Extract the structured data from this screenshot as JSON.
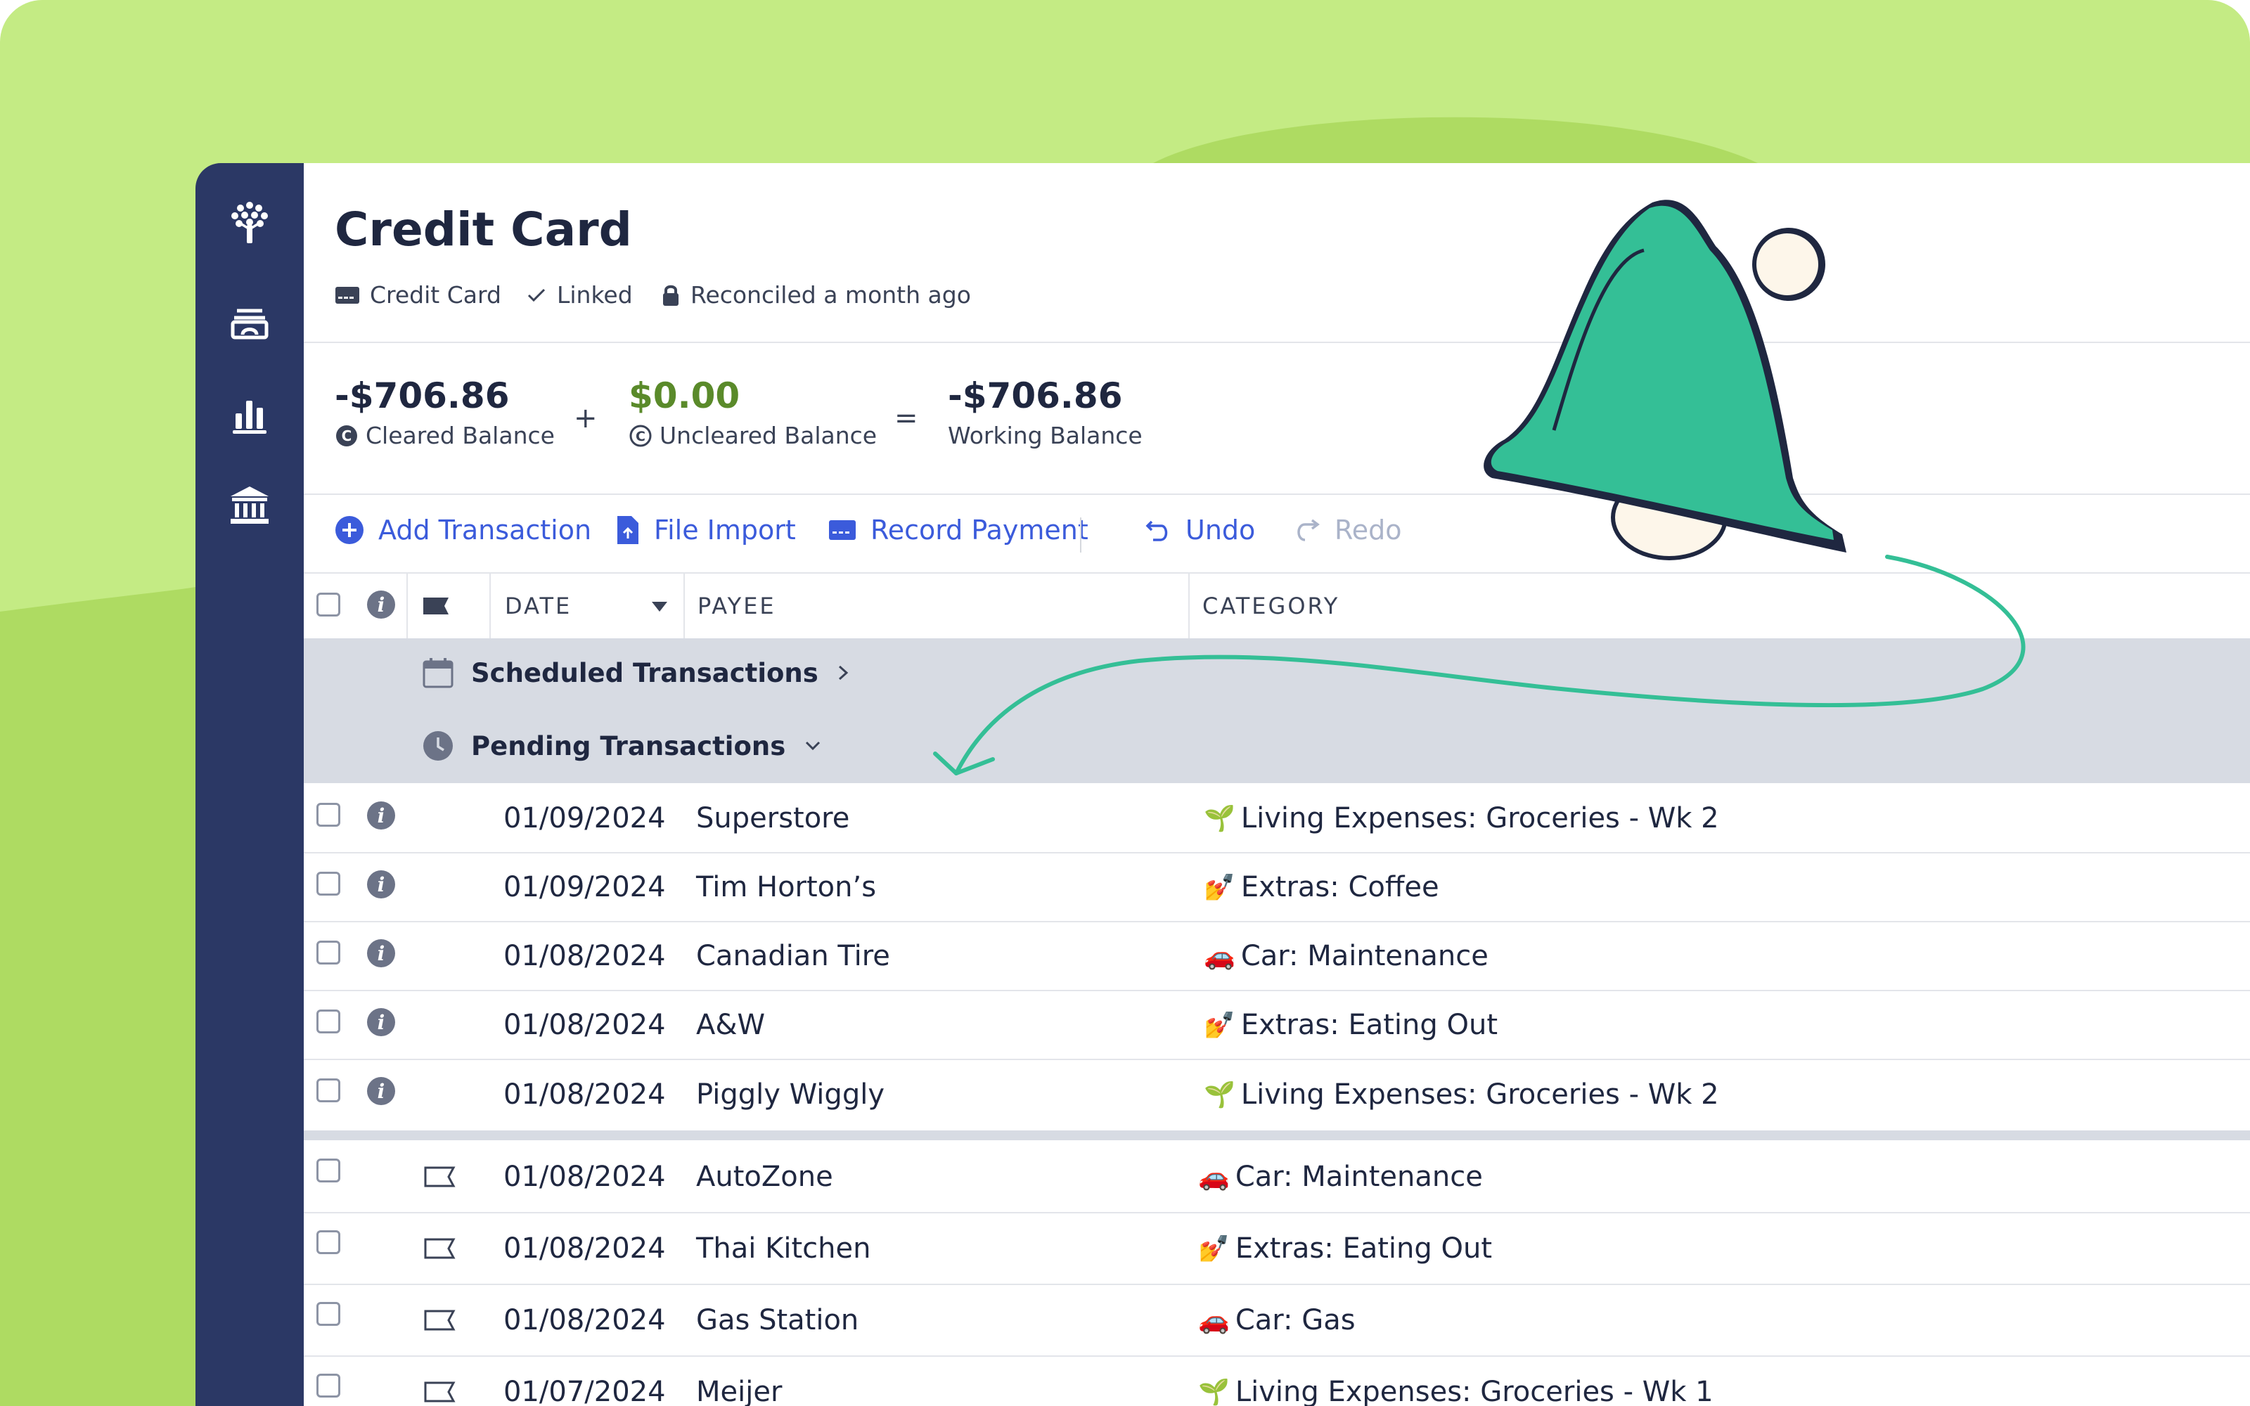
{
  "account": {
    "title": "Credit Card",
    "type_label": "Credit Card",
    "linked_label": "Linked",
    "reconciled_label": "Reconciled a month ago"
  },
  "balances": {
    "cleared": {
      "amount": "-$706.86",
      "label": "Cleared Balance"
    },
    "uncleared": {
      "amount": "$0.00",
      "label": "Uncleared Balance"
    },
    "working": {
      "amount": "-$706.86",
      "label": "Working Balance"
    },
    "plus": "+",
    "equals": "="
  },
  "toolbar": {
    "add_transaction": "Add Transaction",
    "file_import": "File Import",
    "record_payment": "Record Payment",
    "undo": "Undo",
    "redo": "Redo"
  },
  "columns": {
    "date": "DATE",
    "payee": "PAYEE",
    "category": "CATEGORY"
  },
  "groups": {
    "scheduled": "Scheduled Transactions",
    "pending": "Pending Transactions"
  },
  "pending_rows": [
    {
      "date": "01/09/2024",
      "payee": "Superstore",
      "emoji": "🌱",
      "category": "Living Expenses: Groceries - Wk 2"
    },
    {
      "date": "01/09/2024",
      "payee": "Tim Horton’s",
      "emoji": "💅",
      "category": "Extras: Coffee"
    },
    {
      "date": "01/08/2024",
      "payee": "Canadian Tire",
      "emoji": "🚗",
      "category": "Car: Maintenance"
    },
    {
      "date": "01/08/2024",
      "payee": "A&W",
      "emoji": "💅",
      "category": "Extras: Eating Out"
    },
    {
      "date": "01/08/2024",
      "payee": "Piggly Wiggly",
      "emoji": "🌱",
      "category": "Living Expenses: Groceries - Wk 2"
    }
  ],
  "rows": [
    {
      "date": "01/08/2024",
      "payee": "AutoZone",
      "emoji": "🚗",
      "category": "Car: Maintenance"
    },
    {
      "date": "01/08/2024",
      "payee": "Thai Kitchen",
      "emoji": "💅",
      "category": "Extras: Eating Out"
    },
    {
      "date": "01/08/2024",
      "payee": "Gas Station",
      "emoji": "🚗",
      "category": "Car: Gas"
    },
    {
      "date": "01/07/2024",
      "payee": "Meijer",
      "emoji": "🌱",
      "category": "Living Expenses: Groceries - Wk 1"
    }
  ],
  "colors": {
    "background": "#c4eb84",
    "sidebar": "#2b3865",
    "accent": "#3b5bdb",
    "uncleared": "#5a8a2a",
    "bell": "#34bf96",
    "group_bg": "#d7dbe3"
  },
  "icons": {
    "logo": "tree-logo-icon",
    "budget": "budget-icon",
    "reports": "bar-chart-icon",
    "accounts": "bank-icon",
    "notification": "bell-icon",
    "arrow": "curved-arrow-icon"
  }
}
